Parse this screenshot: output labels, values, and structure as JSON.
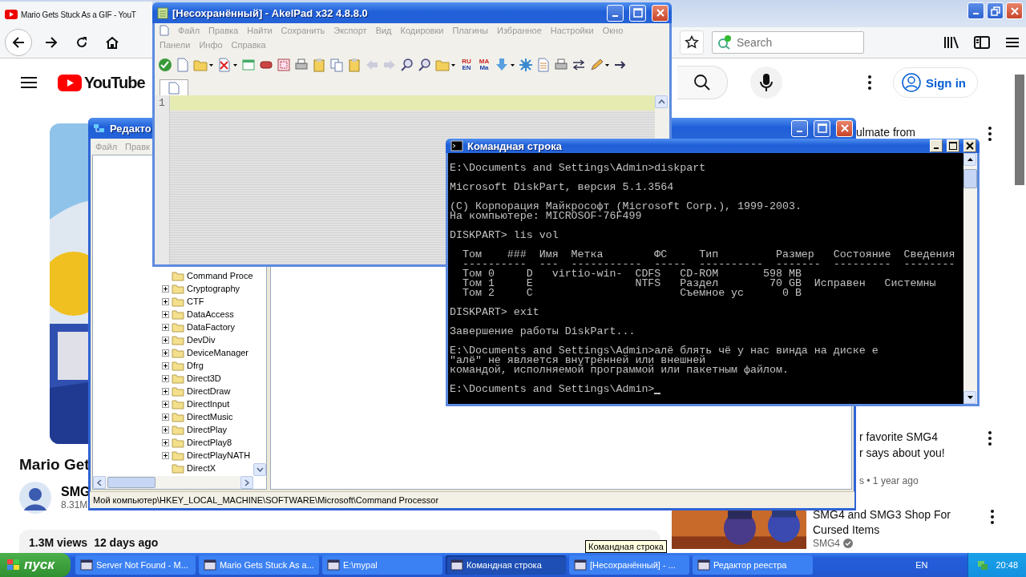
{
  "browser": {
    "tab_title": "Mario Gets Stuck As a GIF - YouT",
    "search_placeholder": "Search"
  },
  "youtube": {
    "logo": "YouTube",
    "sign_in": "Sign in",
    "video_title": "Mario Get",
    "channel": "SMG",
    "subscribers": "8.31M",
    "views": "1.3M views",
    "date": "12 days ago",
    "related": [
      {
        "lines": [
          "ulmate from"
        ]
      },
      {
        "lines": [
          "r favorite SMG4",
          "r says about you!"
        ],
        "meta": "s • 1 year ago"
      },
      {
        "lines": [
          "SMG4 and SMG3 Shop For",
          "Cursed Items"
        ],
        "meta": "SMG4",
        "verified": true,
        "kind": "picture"
      }
    ]
  },
  "regedit": {
    "title": "Редакто",
    "menu": [
      "Файл",
      "Правк"
    ],
    "tree": [
      {
        "label": "Command Proce",
        "expandable": false
      },
      {
        "label": "Cryptography",
        "expandable": true
      },
      {
        "label": "CTF",
        "expandable": true
      },
      {
        "label": "DataAccess",
        "expandable": true
      },
      {
        "label": "DataFactory",
        "expandable": true
      },
      {
        "label": "DevDiv",
        "expandable": true
      },
      {
        "label": "DeviceManager",
        "expandable": true
      },
      {
        "label": "Dfrg",
        "expandable": true
      },
      {
        "label": "Direct3D",
        "expandable": true
      },
      {
        "label": "DirectDraw",
        "expandable": true
      },
      {
        "label": "DirectInput",
        "expandable": true
      },
      {
        "label": "DirectMusic",
        "expandable": true
      },
      {
        "label": "DirectPlay",
        "expandable": true
      },
      {
        "label": "DirectPlay8",
        "expandable": true
      },
      {
        "label": "DirectPlayNATH",
        "expandable": true
      },
      {
        "label": "DirectX",
        "expandable": false
      }
    ],
    "status": "Мой компьютер\\HKEY_LOCAL_MACHINE\\SOFTWARE\\Microsoft\\Command Processor"
  },
  "akelpad": {
    "title": "[Несохранённый] - AkelPad x32 4.8.8.0",
    "menu_rows": [
      [
        "Файл",
        "Правка",
        "Найти",
        "Сохранить",
        "Экспорт",
        "Вид",
        "Кодировки",
        "Плагины",
        "Избранное",
        "Настройки",
        "Окно"
      ],
      [
        "Панели",
        "Инфо",
        "Справка"
      ]
    ],
    "toolbar_texts": [
      [
        "RU",
        "EN"
      ],
      [
        "MA",
        "Ma"
      ]
    ],
    "line_number": "1"
  },
  "cmd": {
    "title": "Командная строка",
    "blocks": [
      [
        "E:\\Documents and Settings\\Admin>diskpart"
      ],
      [
        "Microsoft DiskPart, версия 5.1.3564"
      ],
      [
        "(C) Корпорация Майкрософт (Microsoft Corp.), 1999-2003.",
        "На компьютере: MICROSOF-76F499"
      ],
      [
        "DISKPART> lis vol"
      ],
      [
        "  Том    ###  Имя  Метка        ФС     Тип         Размер   Состояние  Сведения",
        "  ----------  ---  -----------  -----  ----------  -------  ---------  --------",
        "  Том 0     D   virtio-win-  CDFS   CD-ROM       598 MB",
        "  Том 1     E                NTFS   Раздел        70 GB  Исправен   Системны",
        "  Том 2     C                       Съемное ус      0 B"
      ],
      [
        "DISKPART> exit"
      ],
      [
        "Завершение работы DiskPart..."
      ],
      [
        "E:\\Documents and Settings\\Admin>алё блять чё у нас винда на диске е",
        "\"алё\" не является внутренней или внешней",
        "командой, исполняемой программой или пакетным файлом."
      ],
      [
        "E:\\Documents and Settings\\Admin>"
      ]
    ]
  },
  "tooltip": "Командная строка",
  "taskbar": {
    "start": "пуск",
    "items": [
      {
        "label": "Server Not Found - M...",
        "selected": false
      },
      {
        "label": "Mario Gets Stuck As a...",
        "selected": false
      },
      {
        "label": "E:\\mypal",
        "selected": false
      },
      {
        "label": "Командная строка",
        "selected": true
      },
      {
        "label": "[Несохранённый] - ...",
        "selected": false
      },
      {
        "label": "Редактор реестра",
        "selected": false
      }
    ],
    "language": "EN",
    "clock": "20:48"
  }
}
